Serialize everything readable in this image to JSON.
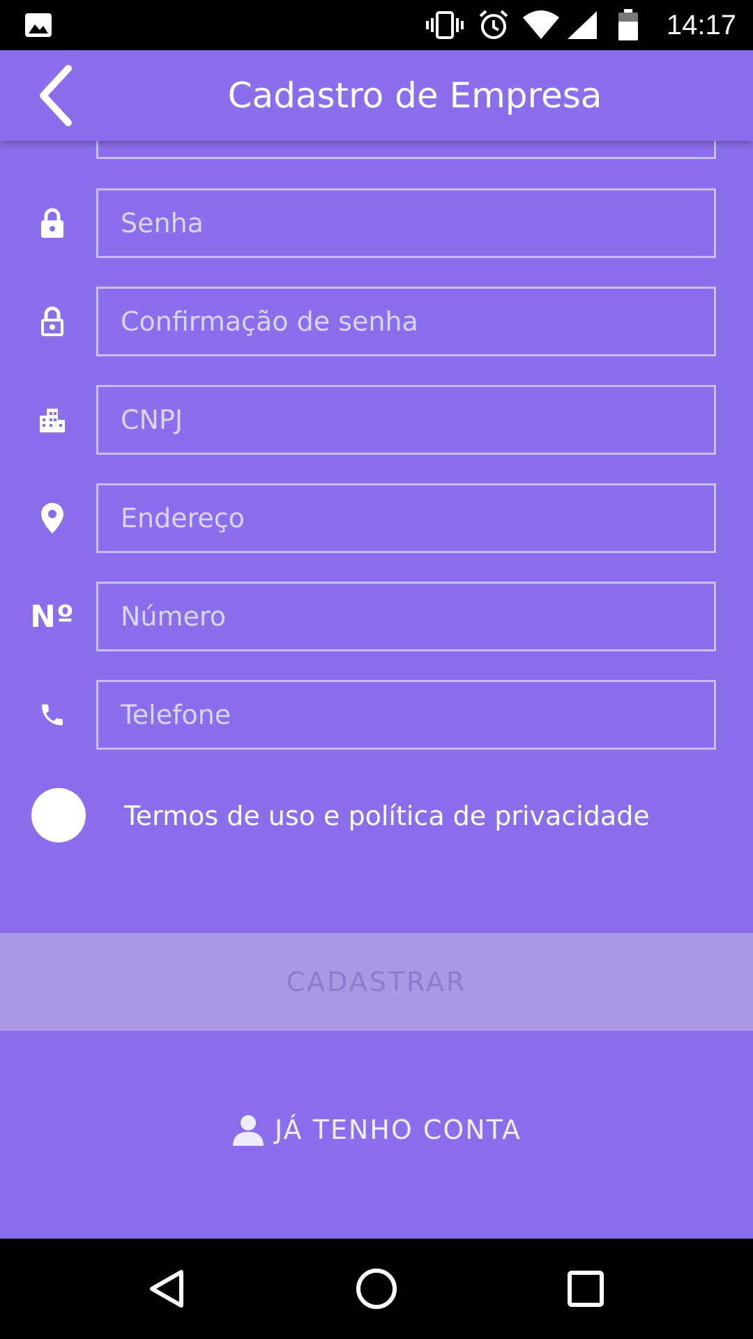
{
  "status_bar": {
    "time": "14:17"
  },
  "app_bar": {
    "title": "Cadastro de Empresa"
  },
  "form": {
    "fields": [
      {
        "name": "password",
        "placeholder": "Senha",
        "icon": "lock-icon"
      },
      {
        "name": "password-confirm",
        "placeholder": "Confirmação de senha",
        "icon": "lock-open-icon"
      },
      {
        "name": "cnpj",
        "placeholder": "CNPJ",
        "icon": "building-icon"
      },
      {
        "name": "address",
        "placeholder": "Endereço",
        "icon": "location-pin-icon"
      },
      {
        "name": "number",
        "placeholder": "Número",
        "icon_text": "Nº"
      },
      {
        "name": "phone",
        "placeholder": "Telefone",
        "icon": "phone-icon"
      }
    ],
    "terms_label": "Termos de uso e política de privacidade",
    "terms_checked": false
  },
  "buttons": {
    "register": "CADASTRAR",
    "have_account": "JÁ TENHO CONTA"
  },
  "colors": {
    "background": "#8a6eeb",
    "field_border": "#c8bcf5",
    "register_disabled": "#a999e5"
  }
}
